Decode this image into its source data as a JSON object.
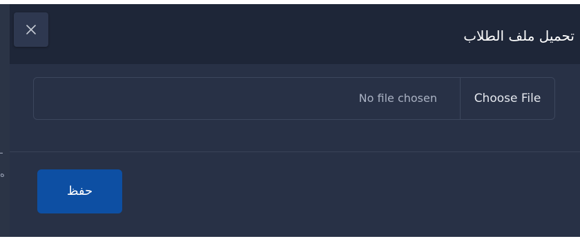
{
  "modal": {
    "title": "تحميل ملف الطلاب",
    "close_icon": "close-icon"
  },
  "file_input": {
    "button_label": "Choose File",
    "status_text": "No file chosen"
  },
  "footer": {
    "save_label": "حفظ"
  },
  "background_text": {
    "line1": "ـ",
    "line2": "ه"
  },
  "colors": {
    "header_bg": "#1e2638",
    "body_bg": "#283146",
    "primary_button": "#0d4fa3"
  }
}
